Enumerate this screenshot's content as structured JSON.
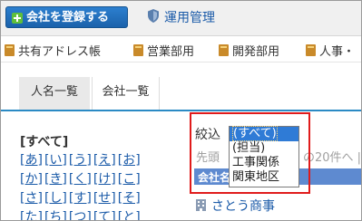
{
  "toolbar": {
    "register_label": "会社を登録する",
    "admin_label": "運用管理"
  },
  "address_books": [
    "共有アドレス帳",
    "営業部用",
    "開発部用",
    "人事・"
  ],
  "tabs": {
    "people": "人名一覧",
    "companies": "会社一覧"
  },
  "index": {
    "all": "[すべて]",
    "rows": [
      [
        "[あ]",
        "[い]",
        "[う]",
        "[え]",
        "[お]"
      ],
      [
        "[か]",
        "[き]",
        "[く]",
        "[け]",
        "[こ]"
      ],
      [
        "[さ]",
        "[し]",
        "[す]",
        "[せ]",
        "[そ]"
      ],
      [
        "[た]",
        "[ち]",
        "[つ]",
        "[て]",
        "[と]"
      ]
    ]
  },
  "filter": {
    "label": "絞込",
    "options": [
      "(すべて)",
      "(担当)",
      "工事関係",
      "関東地区"
    ],
    "selected": "(すべて)"
  },
  "list": {
    "hint_left": "先頭",
    "hint_right": "の20件へ |",
    "header": "会社名",
    "first_company": "さとう商事"
  },
  "colors": {
    "accent": "#1a5aa8",
    "button": "#1b62ab",
    "highlight": "#e01b1b",
    "selection": "#2f7bd6"
  }
}
